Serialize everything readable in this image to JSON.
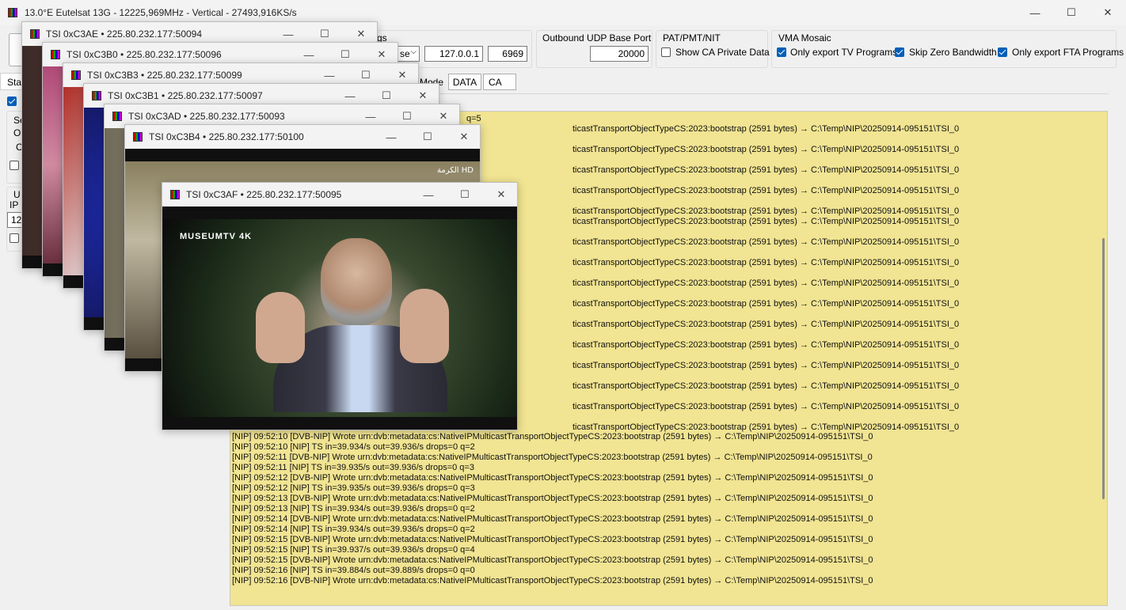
{
  "window": {
    "title": "13.0°E Eutelsat 13G - 12225,969MHz - Vertical - 27493,916KS/s",
    "minimize": "—",
    "maximize": "☐",
    "close": "✕"
  },
  "toolbar": {
    "settings_fragment": "gs",
    "dropdown_fragment": "se",
    "ip_value": "127.0.0.1",
    "port_value": "6969",
    "outbound_label": "Outbound UDP Base Port",
    "outbound_value": "20000",
    "patpmt_label": "PAT/PMT/NIT",
    "show_ca_label": "Show CA Private Data",
    "vma_label": "VMA Mosaic",
    "only_tv_label": "Only export TV Programs",
    "skip_zero_label": "Skip Zero Bandwidth",
    "only_fta_label": "Only export FTA Programs",
    "mode_fragment": "Mode",
    "data_button": "DATA",
    "ca_button": "CA"
  },
  "left_panel": {
    "tab_fragment": "Stat",
    "se_fragment": "Se",
    "ou_fragment": "Ou",
    "c_fragment": "C",
    "u_fragment": "U",
    "ip_fragment": "IP",
    "num_fragment": "12"
  },
  "log": {
    "top_fragment": "q=5",
    "partial_text": "ticastTransportObjectTypeCS:2023:bootstrap (2591 bytes) → C:\\Temp\\NIP\\20250914-095151\\TSI_0",
    "visible_lines": [
      "[NIP] 09:52:10  [DVB-NIP] Wrote urn:dvb:metadata:cs:NativeIPMulticastTransportObjectTypeCS:2023:bootstrap (2591 bytes) → C:\\Temp\\NIP\\20250914-095151\\TSI_0",
      "[NIP] 09:52:10  [NIP] TS in=39.934/s out=39.936/s drops=0 q=2",
      "[NIP] 09:52:11  [DVB-NIP] Wrote urn:dvb:metadata:cs:NativeIPMulticastTransportObjectTypeCS:2023:bootstrap (2591 bytes) → C:\\Temp\\NIP\\20250914-095151\\TSI_0",
      "[NIP] 09:52:11  [NIP] TS in=39.935/s out=39.936/s drops=0 q=3",
      "[NIP] 09:52:12  [DVB-NIP] Wrote urn:dvb:metadata:cs:NativeIPMulticastTransportObjectTypeCS:2023:bootstrap (2591 bytes) → C:\\Temp\\NIP\\20250914-095151\\TSI_0",
      "[NIP] 09:52:12  [NIP] TS in=39.935/s out=39.936/s drops=0 q=3",
      "[NIP] 09:52:13  [DVB-NIP] Wrote urn:dvb:metadata:cs:NativeIPMulticastTransportObjectTypeCS:2023:bootstrap (2591 bytes) → C:\\Temp\\NIP\\20250914-095151\\TSI_0",
      "[NIP] 09:52:13  [NIP] TS in=39.934/s out=39.936/s drops=0 q=2",
      "[NIP] 09:52:14  [DVB-NIP] Wrote urn:dvb:metadata:cs:NativeIPMulticastTransportObjectTypeCS:2023:bootstrap (2591 bytes) → C:\\Temp\\NIP\\20250914-095151\\TSI_0",
      "[NIP] 09:52:14  [NIP] TS in=39.934/s out=39.936/s drops=0 q=2",
      "[NIP] 09:52:15  [DVB-NIP] Wrote urn:dvb:metadata:cs:NativeIPMulticastTransportObjectTypeCS:2023:bootstrap (2591 bytes) → C:\\Temp\\NIP\\20250914-095151\\TSI_0",
      "[NIP] 09:52:15  [NIP] TS in=39.937/s out=39.936/s drops=0 q=4",
      "[NIP] 09:52:15  [DVB-NIP] Wrote urn:dvb:metadata:cs:NativeIPMulticastTransportObjectTypeCS:2023:bootstrap (2591 bytes) → C:\\Temp\\NIP\\20250914-095151\\TSI_0",
      "[NIP] 09:52:16  [NIP] TS in=39.884/s out=39.889/s drops=0 q=0",
      "[NIP] 09:52:16  [DVB-NIP] Wrote urn:dvb:metadata:cs:NativeIPMulticastTransportObjectTypeCS:2023:bootstrap (2591 bytes) → C:\\Temp\\NIP\\20250914-095151\\TSI_0"
    ]
  },
  "players": [
    {
      "title": "TSI 0xC3AE • 225.80.232.177:50094"
    },
    {
      "title": "TSI 0xC3B0 • 225.80.232.177:50096"
    },
    {
      "title": "TSI 0xC3B3 • 225.80.232.177:50099"
    },
    {
      "title": "TSI 0xC3B1 • 225.80.232.177:50097"
    },
    {
      "title": "TSI 0xC3AD • 225.80.232.177:50093"
    },
    {
      "title": "TSI 0xC3B4 • 225.80.232.177:50100"
    },
    {
      "title": "TSI 0xC3AF • 225.80.232.177:50095",
      "watermark": "MUSEUMTV 4K"
    }
  ],
  "channel_logo_text": "الكرمة HD",
  "colors": {
    "log_bg": "#f1e492",
    "accent": "#005fb8"
  }
}
